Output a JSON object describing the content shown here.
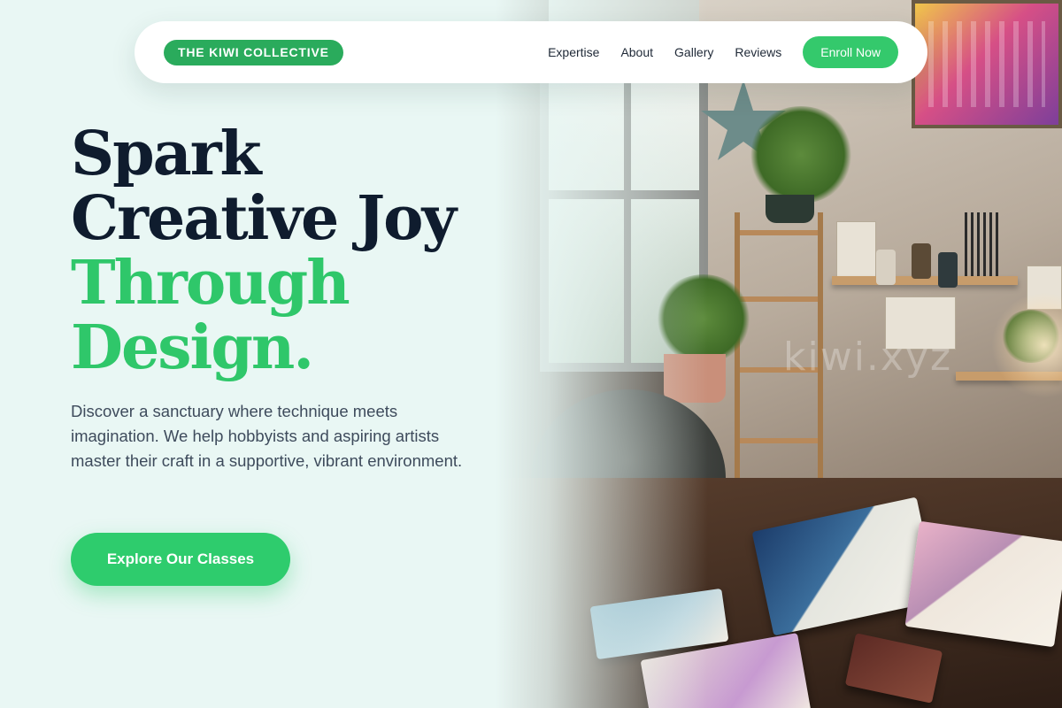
{
  "brand": {
    "name": "THE KIWI COLLECTIVE"
  },
  "nav": {
    "links": [
      {
        "label": "Expertise"
      },
      {
        "label": "About"
      },
      {
        "label": "Gallery"
      },
      {
        "label": "Reviews"
      }
    ],
    "enroll_label": "Enroll Now"
  },
  "hero": {
    "headline_line1": "Spark",
    "headline_line2": "Creative Joy",
    "headline_line3": "Through",
    "headline_line4": "Design.",
    "subtitle": "Discover a sanctuary where technique meets imagination. We help hobbyists and aspiring artists master their craft in a supportive, vibrant environment.",
    "cta_label": "Explore Our Classes",
    "watermark": "kiwi.xyz"
  },
  "colors": {
    "background": "#e9f7f4",
    "brand_green": "#2aab5c",
    "accent_green": "#2fc76a",
    "headline_dark": "#0f1c2e",
    "body_text": "#3e4b5c"
  },
  "icons": {
    "hero_image": "art-studio-photo"
  }
}
